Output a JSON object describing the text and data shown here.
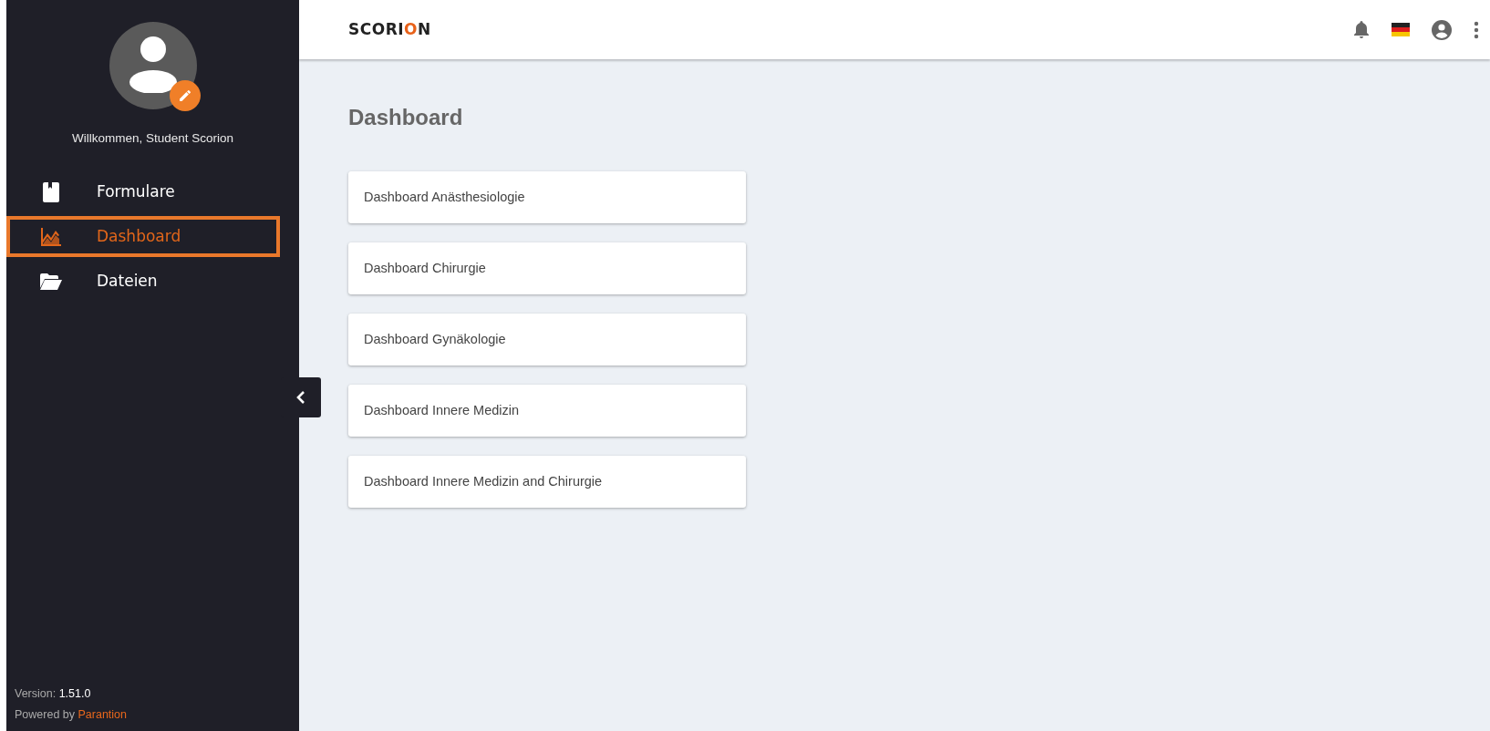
{
  "sidebar": {
    "welcome": "Willkommen, Student Scorion",
    "items": [
      {
        "label": "Formulare",
        "kind": "form",
        "selected": false
      },
      {
        "label": "Dashboard",
        "kind": "chart",
        "selected": true
      },
      {
        "label": "Dateien",
        "kind": "folder",
        "selected": false
      }
    ],
    "version_label": "Version: ",
    "version": "1.51.0",
    "powered_label": "Powered by ",
    "powered_link": "Parantion"
  },
  "header": {
    "logo": [
      {
        "text": "SCORI",
        "accent": false
      },
      {
        "text": "O",
        "accent": true
      },
      {
        "text": "N",
        "accent": false
      }
    ]
  },
  "page": {
    "title": "Dashboard",
    "dashboards": [
      {
        "label": "Dashboard Anästhesiologie"
      },
      {
        "label": "Dashboard Chirurgie"
      },
      {
        "label": "Dashboard Gynäkologie"
      },
      {
        "label": "Dashboard Innere Medizin"
      },
      {
        "label": "Dashboard Innere Medizin and Chirurgie"
      }
    ]
  }
}
